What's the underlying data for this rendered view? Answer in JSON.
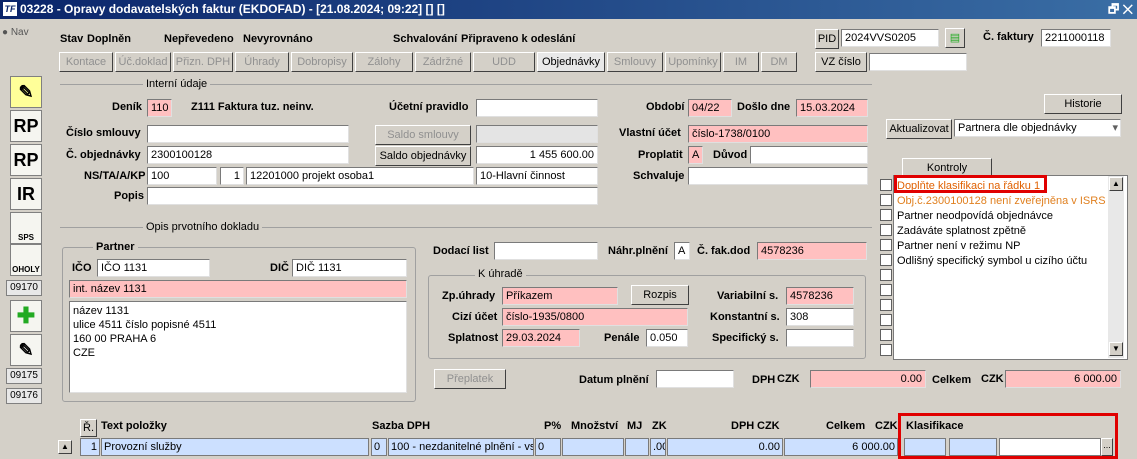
{
  "window": {
    "title": "03228 - Opravy dodavatelských faktur (EKDOFAD) - [21.08.2024; 09:22] [] []",
    "app_icon": "TF",
    "restore_close": "🗗 ✕"
  },
  "leftbar": {
    "nav_label": "Nav",
    "icons": [
      "RP",
      "RP",
      "IR",
      "SPS",
      "OHOLY"
    ],
    "nums": [
      "09170",
      "09175",
      "09176"
    ]
  },
  "status": {
    "stav_label": "Stav",
    "stav_value": "Doplněn",
    "neprevedeno": "Nepřevedeno",
    "nevyrovnano": "Nevyrovnáno",
    "schvalovani_label": "Schvalování",
    "schvalovani_value": "Připraveno k odeslání"
  },
  "pid": {
    "label": "PID",
    "value": "2024VVS0205"
  },
  "faktura": {
    "label": "Č. faktury",
    "value": "2211000118"
  },
  "tabs": [
    "Kontace",
    "Úč.doklad",
    "Přizn. DPH",
    "Úhrady",
    "Dobropisy",
    "Zálohy",
    "Zádržné",
    "UDD",
    "Objednávky",
    "Smlouvy",
    "Upomínky",
    "IM",
    "DM"
  ],
  "vz_cislo_label": "VZ číslo",
  "interni": {
    "title": "Interní údaje",
    "denik_label": "Deník",
    "denik_value": "110",
    "denik_name": "Z111 Faktura tuz. neinv.",
    "ucetni_pravidlo_label": "Účetní pravidlo",
    "cislo_smlouvy_label": "Číslo smlouvy",
    "saldo_smlouvy_btn": "Saldo smlouvy",
    "c_objednavky_label": "Č. objednávky",
    "c_objednavky_value": "2300100128",
    "saldo_objednavky_btn": "Saldo objednávky",
    "saldo_objednavky_value": "1 455 600.00",
    "ns_label": "NS/TA/A/KP",
    "ns_value": "100",
    "ta_value": "1",
    "a_value": "12201000 projekt osoba1",
    "kp_value": "10-Hlavní činnost",
    "popis_label": "Popis",
    "obdobi_label": "Období",
    "obdobi_value": "04/22",
    "doslo_label": "Došlo dne",
    "doslo_value": "15.03.2024",
    "vlastni_ucet_label": "Vlastní účet",
    "vlastni_ucet_value": "číslo-1738/0100",
    "proplatit_label": "Proplatit",
    "proplatit_value": "A",
    "duvod_label": "Důvod",
    "schvaluje_label": "Schvaluje"
  },
  "historie_btn": "Historie",
  "aktualizovat_btn": "Aktualizovat",
  "aktualizovat_select": "Partnera dle objednávky",
  "kontroly": {
    "title": "Kontroly",
    "items": [
      {
        "text": "Doplňte klasifikaci na řádku 1",
        "color": "#e06000"
      },
      {
        "text": "Obj.č.2300100128 není zveřejněna v ISRS",
        "color": "#e08020"
      },
      {
        "text": "Partner neodpovídá objednávce",
        "color": "#000000"
      },
      {
        "text": "Zadáváte splatnost zpětně",
        "color": "#000000"
      },
      {
        "text": "Partner není v režimu NP",
        "color": "#000000"
      },
      {
        "text": "Odlišný specifický symbol u cizího účtu",
        "color": "#000000"
      }
    ]
  },
  "opis": {
    "title": "Opis prvotního dokladu",
    "partner_title": "Partner",
    "ico_label": "IČO",
    "ico_value": "IČO 1131",
    "dic_label": "DIČ",
    "dic_value": "DIČ 1131",
    "int_nazev": "int. název 1131",
    "address": [
      "název 1131",
      "ulice 4511 číslo popisné 4511",
      "160 00 PRAHA 6",
      "CZE"
    ],
    "dodaci_list_label": "Dodací list",
    "nahr_plneni_label": "Náhr.plnění",
    "nahr_plneni_value": "A",
    "c_fak_dod_label": "Č. fak.dod",
    "c_fak_dod_value": "4578236"
  },
  "k_uhrade": {
    "title": "K úhradě",
    "zp_uhrady_label": "Zp.úhrady",
    "zp_uhrady_value": "Příkazem",
    "rozpis_btn": "Rozpis",
    "variabilni_label": "Variabilní s.",
    "variabilni_value": "4578236",
    "cizi_ucet_label": "Cizí účet",
    "cizi_ucet_value": "číslo-1935/0800",
    "konstantni_label": "Konstantní s.",
    "konstantni_value": "308",
    "splatnost_label": "Splatnost",
    "splatnost_value": "29.03.2024",
    "penale_label": "Penále",
    "penale_value": "0.050",
    "specificky_label": "Specifický s."
  },
  "preplatek_btn": "Přeplatek",
  "datum_plneni_label": "Datum plnění",
  "dph_label": "DPH",
  "dph_curr": "CZK",
  "dph_value": "0.00",
  "celkem_label": "Celkem",
  "celkem_curr": "CZK",
  "celkem_value": "6 000.00",
  "polozky": {
    "headers": {
      "r": "Ř.",
      "text": "Text položky",
      "sazba": "Sazba DPH",
      "p": "P%",
      "mnozstvi": "Množství",
      "mj": "MJ",
      "zk": "ZK",
      "dph": "DPH",
      "dph_curr": "CZK",
      "celkem": "Celkem",
      "celkem_curr": "CZK",
      "klasifikace": "Klasifikace"
    },
    "row": {
      "r": "1",
      "text": "Provozní služby",
      "sazba_code": "0",
      "sazba_text": "100 - nezdanitelné plnění - vs",
      "p": "0",
      "zk": ".00",
      "dph": "0.00",
      "celkem": "6 000.00",
      "more_btn": "..."
    }
  }
}
